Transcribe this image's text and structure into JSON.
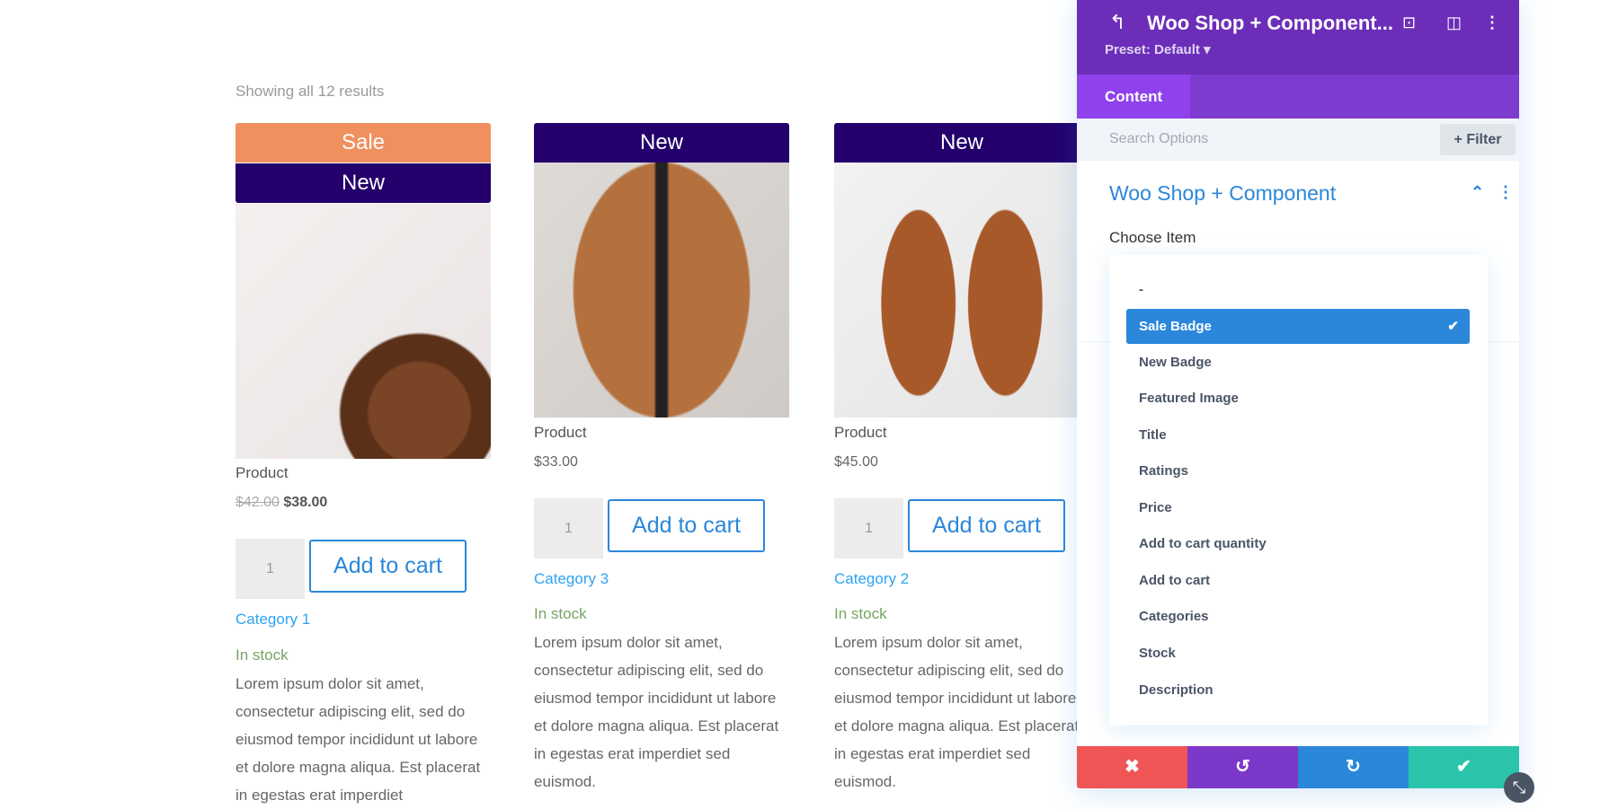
{
  "shop": {
    "results_text": "Showing all 12 results",
    "products": [
      {
        "badges": [
          "Sale",
          "New"
        ],
        "title": "Product",
        "old_price": "$42.00",
        "price": "$38.00",
        "qty": "1",
        "add_to_cart": "Add to cart",
        "category": "Category 1",
        "stock": "In stock",
        "description": "Lorem ipsum dolor sit amet, consectetur adipiscing elit, sed do eiusmod tempor incididunt ut labore et dolore magna aliqua. Est placerat in egestas erat imperdiet"
      },
      {
        "badges": [
          "New"
        ],
        "title": "Product",
        "price": "$33.00",
        "qty": "1",
        "add_to_cart": "Add to cart",
        "category": "Category 3",
        "stock": "In stock",
        "description": "Lorem ipsum dolor sit amet, consectetur adipiscing elit, sed do eiusmod tempor incididunt ut labore et dolore magna aliqua. Est placerat in egestas erat imperdiet sed euismod."
      },
      {
        "badges": [
          "New"
        ],
        "title": "Product",
        "price": "$45.00",
        "qty": "1",
        "add_to_cart": "Add to cart",
        "category": "Category 2",
        "stock": "In stock",
        "description": "Lorem ipsum dolor sit amet, consectetur adipiscing elit, sed do eiusmod tempor incididunt ut labore et dolore magna aliqua. Est placerat in egestas erat imperdiet sed euismod."
      }
    ]
  },
  "panel": {
    "title": "Woo Shop + Component...",
    "preset": "Preset: Default ▾",
    "tab": "Content",
    "search_placeholder": "Search Options",
    "filter_label": "+ Filter",
    "section_title": "Woo Shop + Component",
    "field_label": "Choose Item",
    "options": [
      "-",
      "Sale Badge",
      "New Badge",
      "Featured Image",
      "Title",
      "Ratings",
      "Price",
      "Add to cart quantity",
      "Add to cart",
      "Categories",
      "Stock",
      "Description"
    ],
    "selected": "Sale Badge",
    "colors": {
      "header": "#6c2eb9",
      "cancel": "#ef5555",
      "undo": "#7b38c9",
      "redo": "#2b87da",
      "save": "#29c4a9"
    }
  }
}
